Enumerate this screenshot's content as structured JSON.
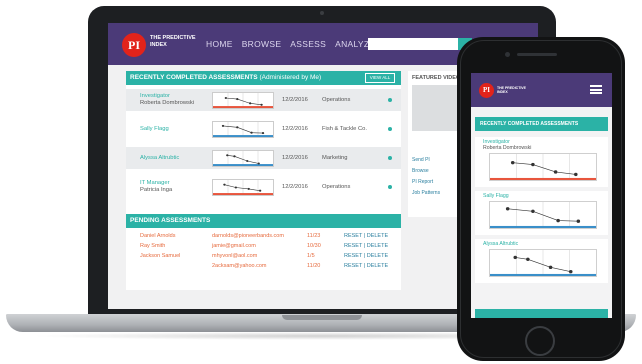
{
  "app": {
    "logo_mark": "PI",
    "logo_text": "THE PREDICTIVE INDEX",
    "nav": [
      "HOME",
      "BROWSE",
      "ASSESS",
      "ANALYZE"
    ],
    "search_placeholder": ""
  },
  "recent": {
    "title": "RECENTLY COMPLETED ASSESSMENTS",
    "subtitle": "(Administered by Me)",
    "view_all": "VIEW ALL",
    "rows": [
      {
        "role": "Investigator",
        "name": "Roberta Dombrowski",
        "date": "12/2/2016",
        "dept": "Operations",
        "bar_color": "#e8553d"
      },
      {
        "role": "",
        "name": "Sally Flagg",
        "date": "12/2/2016",
        "dept": "Fish & Tackle Co.",
        "bar_color": "#3a8fc9"
      },
      {
        "role": "",
        "name": "Alyssa Altrubtic",
        "date": "12/2/2016",
        "dept": "Marketing",
        "bar_color": "#3a8fc9"
      },
      {
        "role": "IT Manager",
        "name": "Patricia Inga",
        "date": "12/2/2016",
        "dept": "Operations",
        "bar_color": "#e8553d"
      }
    ]
  },
  "featured": {
    "title": "FEATURED VIDEOS",
    "links": [
      "Send PI",
      "Browse",
      "PI Report",
      "Job Patterns"
    ]
  },
  "pending": {
    "title": "PENDING ASSESSMENTS",
    "rows": [
      {
        "name": "Daniel Arnolds",
        "email": "darnolds@pioneerbands.com",
        "date": "11/23",
        "actions": "RESET | DELETE"
      },
      {
        "name": "Ray Smith",
        "email": "jamie@gmail.com",
        "date": "10/30",
        "actions": "RESET | DELETE"
      },
      {
        "name": "Jackson Samuel",
        "email": "mhyvonl@aol.com",
        "date": "1/5",
        "actions": "RESET | DELETE"
      },
      {
        "name": "",
        "email": "2acksam@yahoo.com",
        "date": "11/20",
        "actions": "RESET | DELETE"
      }
    ]
  },
  "mobile": {
    "logo_mark": "PI",
    "logo_text": "THE PREDICTIVE INDEX",
    "header": "RECENTLY COMPLETED ASSESSMENTS",
    "cards": [
      {
        "role": "Investigator",
        "name": "Roberta Dombrowski",
        "bar_color": "#e8553d"
      },
      {
        "role": "",
        "name": "Sally Flagg",
        "bar_color": "#3a8fc9"
      },
      {
        "role": "",
        "name": "Alyssa Altrubtic",
        "bar_color": "#3a8fc9"
      }
    ]
  },
  "colors": {
    "nav_purple": "#4b3a78",
    "accent_teal": "#2bb2a6",
    "logo_red": "#e2231a",
    "pending_orange": "#e66a3d"
  }
}
